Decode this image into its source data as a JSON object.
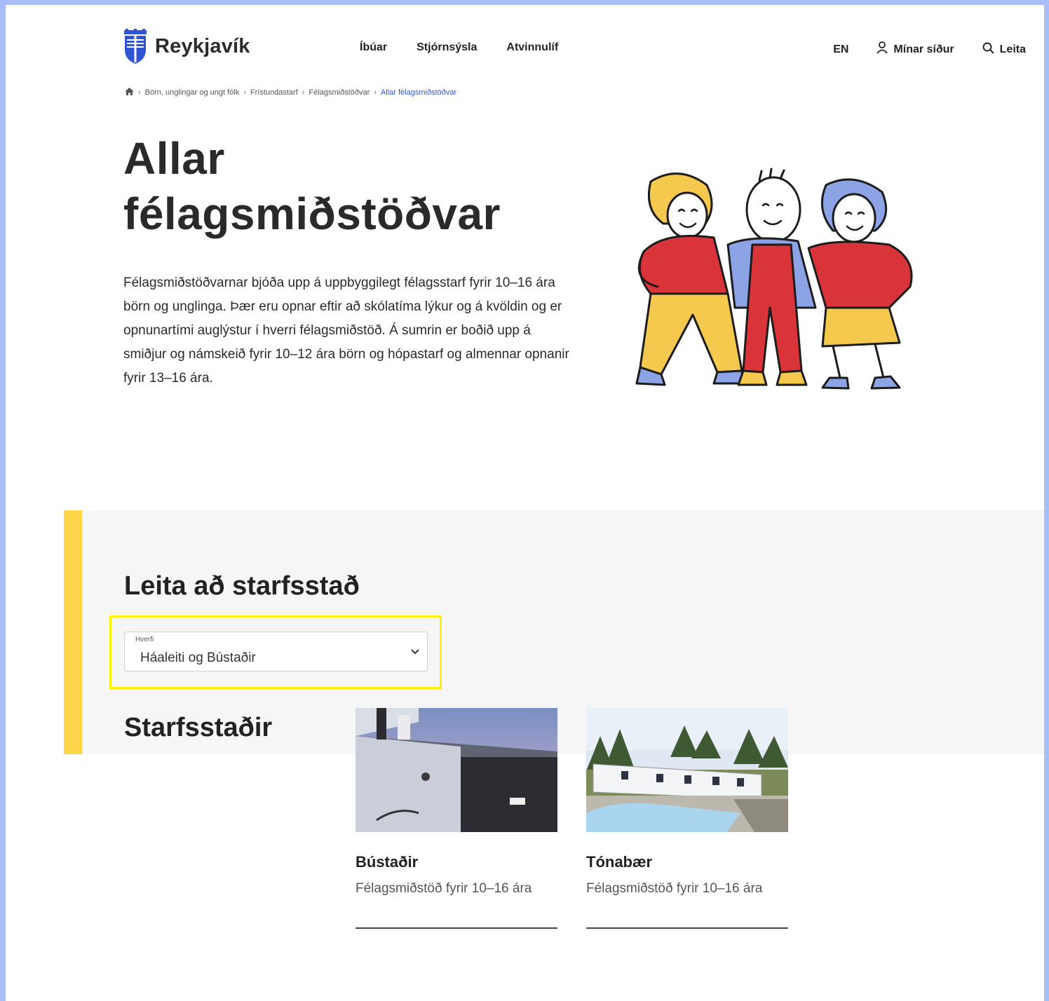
{
  "header": {
    "logo_text": "Reykjavík",
    "nav": [
      "Íbúar",
      "Stjórnsýsla",
      "Atvinnulíf"
    ],
    "lang": "EN",
    "my_pages": "Mínar síður",
    "search": "Leita"
  },
  "breadcrumb": {
    "items": [
      "Börn, unglingar og ungt fólk",
      "Frístundastarf",
      "Félagsmiðstöðvar"
    ],
    "current": "Allar félagsmiðstöðvar"
  },
  "hero": {
    "title": "Allar félagsmiðstöðvar",
    "intro": "Félagsmiðstöðvarnar bjóða upp á uppbyggilegt félagsstarf fyrir 10–16 ára börn og unglinga. Þær eru opnar eftir að skólatíma lýkur og á kvöldin og er opnunartími auglýstur í hverri félagsmiðstöð. Á sumrin er boðið upp á smiðjur og námskeið fyrir 10–12 ára börn og hópastarf og almennar opnanir fyrir 13–16 ára."
  },
  "search": {
    "heading": "Leita að starfsstað",
    "select_label": "Hverfi",
    "select_value": "Háaleiti og Bústaðir"
  },
  "workplaces": {
    "heading": "Starfsstaðir",
    "cards": [
      {
        "name": "Bústaðir",
        "desc": "Félagsmiðstöð fyrir 10–16 ára"
      },
      {
        "name": "Tónabær",
        "desc": "Félagsmiðstöð fyrir 10–16 ára"
      }
    ]
  },
  "colors": {
    "accent_yellow": "#fdd54a",
    "highlight": "#fff200",
    "link_blue": "#2f55d4",
    "frame_blue": "#a9bdfb"
  },
  "icons": [
    "reykjavik-crest-icon",
    "home-icon",
    "user-icon",
    "search-icon",
    "chevron-down-icon"
  ]
}
